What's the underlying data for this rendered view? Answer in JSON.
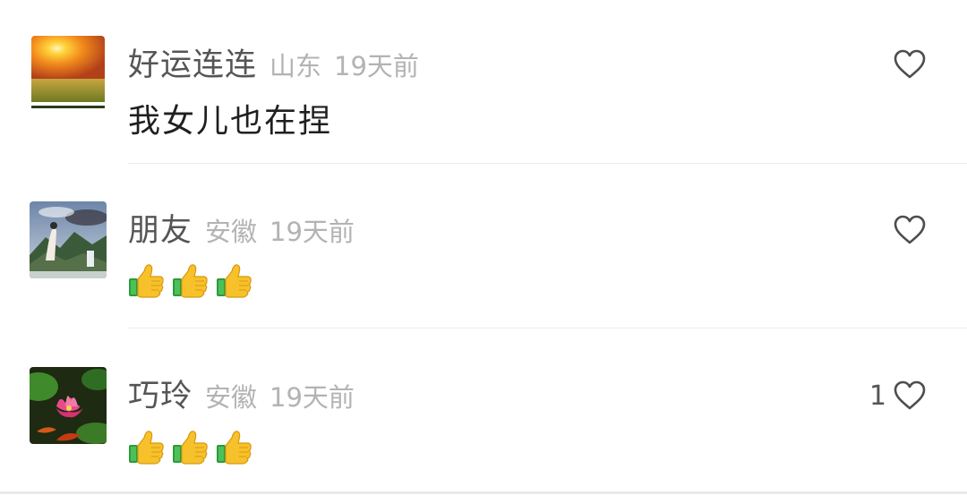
{
  "comments": [
    {
      "name": "好运连连",
      "location": "山东",
      "time": "19天前",
      "text": "我女儿也在捏",
      "likes": "",
      "avatar": "sunset-field-avatar"
    },
    {
      "name": "朋友",
      "location": "安徽",
      "time": "19天前",
      "emoji": [
        "👍",
        "👍",
        "👍"
      ],
      "likes": "",
      "avatar": "landscape-painting-avatar"
    },
    {
      "name": "巧玲",
      "location": "安徽",
      "time": "19天前",
      "emoji": [
        "👍",
        "👍",
        "👍"
      ],
      "likes": "1",
      "avatar": "lotus-flower-avatar"
    }
  ],
  "colors": {
    "name": "#555555",
    "meta": "#b3b3b3",
    "text": "#1f1f1f",
    "divider": "#ececec"
  },
  "icons": {
    "like": "heart-outline-icon",
    "emoji": "thumbs-up-icon"
  }
}
